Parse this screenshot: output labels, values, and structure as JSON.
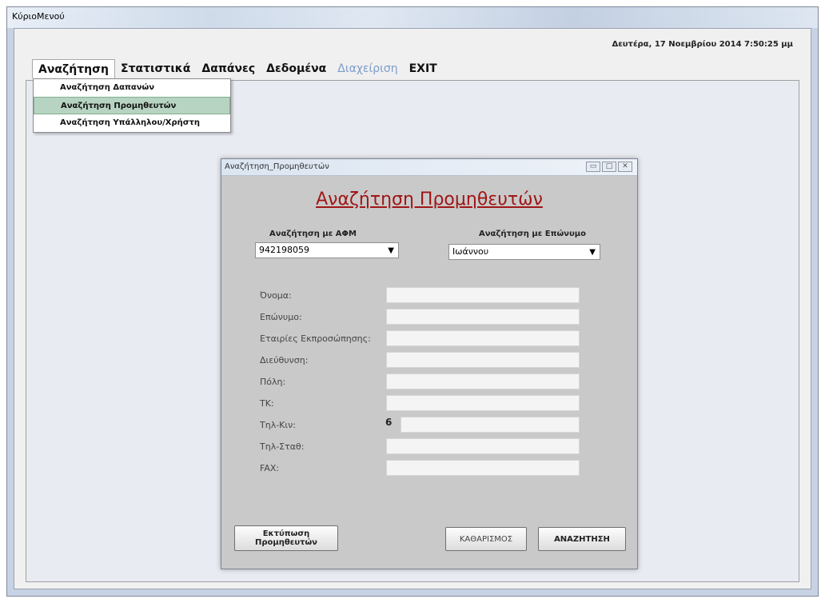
{
  "window": {
    "title": "ΚύριοΜενού"
  },
  "datetime": "Δευτέρα, 17 Νοεμβρίου 2014 7:50:25 μμ",
  "menubar": {
    "items": [
      {
        "label": "Αναζήτηση"
      },
      {
        "label": "Στατιστικά"
      },
      {
        "label": "Δαπάνες"
      },
      {
        "label": "Δεδομένα"
      },
      {
        "label": "Διαχείριση"
      },
      {
        "label": "EXIT"
      }
    ]
  },
  "dropdown": {
    "items": [
      {
        "label": "Αναζήτηση Δαπανών"
      },
      {
        "label": "Αναζήτηση Προμηθευτών"
      },
      {
        "label": "Αναζήτηση Υπάλληλου/Χρήστη"
      }
    ]
  },
  "dialog": {
    "title": "Αναζήτηση_Προμηθευτών",
    "heading": "Αναζήτηση Προμηθευτών",
    "afm_label": "Αναζήτηση με ΑΦΜ",
    "afm_value": "942198059",
    "surname_label": "Αναζήτηση με Επώνυμο",
    "surname_value": "Ιωάννου",
    "fields": [
      {
        "label": "Όνομα:"
      },
      {
        "label": "Επώνυμο:"
      },
      {
        "label": "Εταιρίες Εκπροσώπησης:"
      },
      {
        "label": "Διεύθυνση:"
      },
      {
        "label": "Πόλη:"
      },
      {
        "label": "ΤΚ:"
      },
      {
        "label": "Τηλ-Κιν:",
        "prefix": "6"
      },
      {
        "label": "Τηλ-Σταθ:"
      },
      {
        "label": "FAX:"
      }
    ],
    "print_button": "Εκτύπωση Προμηθευτών",
    "clear_button": "ΚΑΘΑΡΙΣΜΟΣ",
    "search_button": "ΑΝΑΖΗΤΗΣΗ"
  },
  "icons": {
    "minimize": "minimize-icon",
    "maximize": "maximize-icon",
    "close": "close-icon",
    "dropdown_arrow": "chevron-down-icon"
  }
}
